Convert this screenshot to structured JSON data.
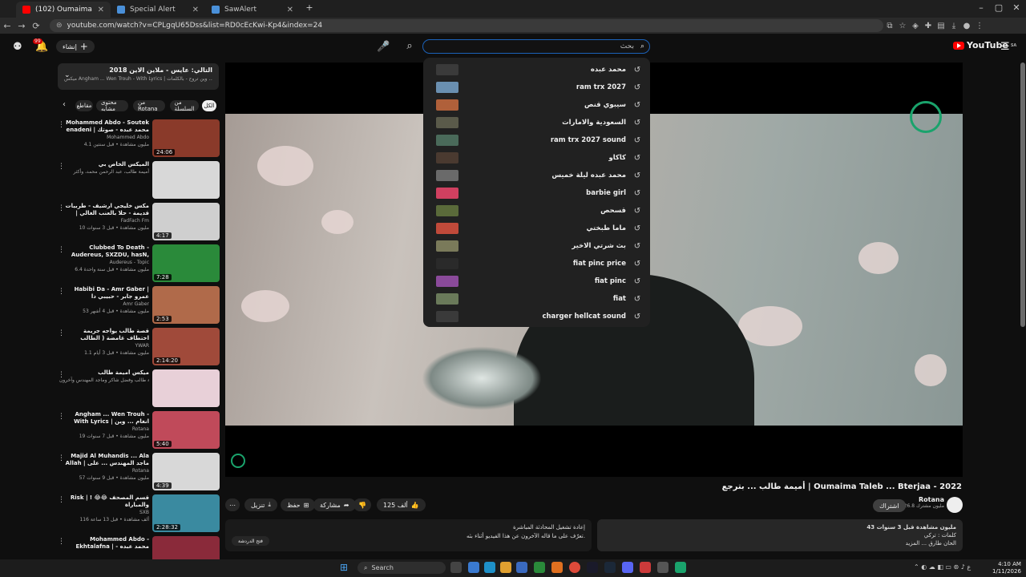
{
  "browser": {
    "tabs": [
      {
        "label": "(102) Oumaima Taleb ... Bterjaa",
        "color": "#ff0000",
        "active": true
      },
      {
        "label": "Special Alert",
        "color": "#4a90d9",
        "active": false
      },
      {
        "label": "SawAlert",
        "color": "#4a90d9",
        "active": false
      }
    ],
    "url": "youtube.com/watch?v=CPLgqU65Dss&list=RD0cEcKwi-Kp4&index=24"
  },
  "header": {
    "notif_count": "99",
    "create_label": "إنشاء",
    "search_placeholder": "بحث",
    "logo_text": "YouTube",
    "country": "SA"
  },
  "search_suggestions": [
    {
      "text": "محمد عبده",
      "thumb": "#3a3a3a"
    },
    {
      "text": "ram trx 2027",
      "thumb": "#6a8fb0"
    },
    {
      "text": "سيبوي قنص",
      "thumb": "#b0603a"
    },
    {
      "text": "السعودية والامارات",
      "thumb": "#5a5a4a"
    },
    {
      "text": "ram trx 2027 sound",
      "thumb": "#4a6a5a"
    },
    {
      "text": "كاكاو",
      "thumb": "#4a3a30"
    },
    {
      "text": "محمد عبده ليلة خميس",
      "thumb": "#6a6a6a"
    },
    {
      "text": "barbie girl",
      "thumb": "#d04060"
    },
    {
      "text": "قسحص",
      "thumb": "#5a6a3a"
    },
    {
      "text": "ماما طبختي",
      "thumb": "#c04a3a"
    },
    {
      "text": "بث شرتي الاخير",
      "thumb": "#7a7a5a"
    },
    {
      "text": "fiat pinc price",
      "thumb": "#2a2a2a"
    },
    {
      "text": "fiat pinc",
      "thumb": "#8a4a9a"
    },
    {
      "text": "fiat",
      "thumb": "#6a7a5a"
    },
    {
      "text": "charger hellcat sound",
      "thumb": "#3a3a3a"
    }
  ],
  "playlist": {
    "title": "التالي: عايس - ملاين الاين 2018",
    "subtitle": "ميكس Angham ... Wen Trouh - With Lyrics | انغام ... وين تروح - بالكلمات",
    "chips": [
      "الكل",
      "من السلسلة",
      "من Rotana",
      "محتوى مشابه",
      "مقاطع"
    ],
    "items": [
      {
        "title": "Mohammed Abdo - Soutek enadeni | محمد عبده - صوتك يناديني",
        "channel": "Mohammed Abdo",
        "meta": "4.1 مليون مشاهدة • قبل سنتين",
        "duration": "24:06",
        "thumb": "#8a3a2a"
      },
      {
        "title": "الميكس الخاص بي",
        "channel": "أميمة طالب، عبد الرحمن محمد، وأكثر",
        "meta": "",
        "duration": "",
        "thumb": "#d8d8d8"
      },
      {
        "title": "مكس خليجي ارشيف - طربيات قديمة - حلا بالعنب الغالي | طرب عراقي",
        "channel": "FadFach Fm",
        "meta": "10 مليون مشاهدة • قبل 3 سنوات",
        "duration": "4:17",
        "thumb": "#cfcfcf"
      },
      {
        "title": "Clubbed To Death - Audereus, SXZDU, hasN, Lythx, sixzee",
        "channel": "Audereus - Topic",
        "meta": "6.4 مليون مشاهدة • قبل سنة واحدة",
        "duration": "7:28",
        "thumb": "#2a8a3a"
      },
      {
        "title": "Habibi Da - Amr Gaber | عمرو جابر - حبيبي دا",
        "channel": "Amr Gaber",
        "meta": "53 مليون مشاهدة • قبل 4 أشهر",
        "duration": "2:53",
        "thumb": "#b06a4a"
      },
      {
        "title": "قصة طالب يواجه جريمة اختطاف غامضة ( الطالب المغدور )",
        "channel": "YWAR",
        "meta": "1.1 مليون مشاهدة • قبل 3 أيام",
        "duration": "2:14:20",
        "thumb": "#a04a3a"
      },
      {
        "title": "ميكس أميمة طالب",
        "channel": "أميمة طالب وفضل شاكر وماجد المهندس وآخرون",
        "meta": "",
        "duration": "",
        "thumb": "#e8d0d8"
      },
      {
        "title": "Angham ... Wen Trouh - With Lyrics | انغام ... وين تروح - بالكلمات",
        "channel": "Rotana",
        "meta": "19 مليون مشاهدة • قبل 7 سنوات",
        "duration": "5:40",
        "thumb": "#c04a5a"
      },
      {
        "title": "Majid Al Muhandis ... Ala Allah | ماجد المهندس ... على الله",
        "channel": "Rotana",
        "meta": "57 مليون مشاهدة • قبل 9 سنوات",
        "duration": "4:39",
        "thumb": "#d8d8d8"
      },
      {
        "title": "Risk | ! 😂😂 قسم المصحف والمباراة",
        "channel": "SXB",
        "meta": "116 ألف مشاهدة • قبل 13 ساعة",
        "duration": "2:28:32",
        "thumb": "#3a8aa0"
      },
      {
        "title": "Mohammed Abdo - Ekhtalafna | محمد عبده - اختلفنا",
        "channel": "",
        "meta": "",
        "duration": "",
        "thumb": "#8a2a3a"
      }
    ]
  },
  "video": {
    "title": "أميمة طالب ... بترجع | Oumaima Taleb ... Bterjaa - 2022",
    "channel": "Rotana",
    "subscribers": "26.8 مليون مشترك",
    "subscribe_label": "اشتراك",
    "likes": "125 ألف",
    "share_label": "مشاركة",
    "save_label": "حفظ",
    "download_label": "تنزيل",
    "views_line": "43 مليون مشاهدة  قبل 3 سنوات",
    "desc_line2": "كلمات : تركي",
    "desc_line3": "الحان طارق ... المزيد",
    "chat_title": "إعادة تشغيل المحادثة المباشرة",
    "chat_body": "تعرّف على ما قاله الآخرون عن هذا الفيديو أثناء بثه.",
    "chat_button": "فتح الدردشة"
  },
  "taskbar": {
    "search_label": "Search",
    "time": "4:10 AM",
    "date": "1/11/2026"
  }
}
